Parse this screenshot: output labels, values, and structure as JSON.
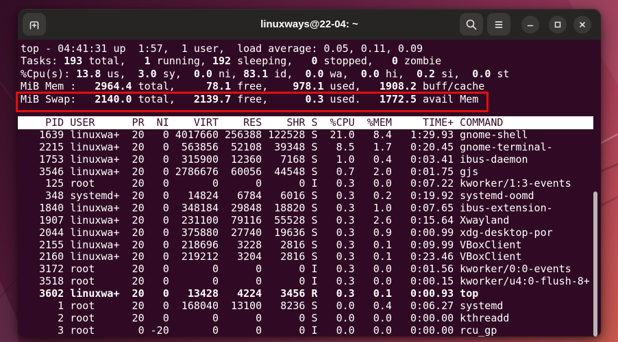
{
  "window": {
    "title": "linuxways@22-04: ~",
    "buttons": {
      "new_tab": "new-tab",
      "search": "search",
      "menu": "hamburger-menu",
      "minimize": "minimize",
      "maximize": "maximize",
      "close": "close"
    }
  },
  "colors": {
    "terminal_background": "#300a24",
    "titlebar_background": "#272424",
    "highlight_red": "#e60d0d",
    "header_invert_background": "#ffffff"
  },
  "terminal": {
    "summary": [
      [
        {
          "t": "top - 04:41:31 up  1:57,  1 user,  load average: 0.05, 0.11, 0.09",
          "b": false
        }
      ],
      [
        {
          "t": "Tasks: ",
          "b": false
        },
        {
          "t": "193",
          "b": true
        },
        {
          "t": " total,   ",
          "b": false
        },
        {
          "t": "1",
          "b": true
        },
        {
          "t": " running, ",
          "b": false
        },
        {
          "t": "192",
          "b": true
        },
        {
          "t": " sleeping,   ",
          "b": false
        },
        {
          "t": "0",
          "b": true
        },
        {
          "t": " stopped,   ",
          "b": false
        },
        {
          "t": "0",
          "b": true
        },
        {
          "t": " zombie",
          "b": false
        }
      ],
      [
        {
          "t": "%Cpu(s): ",
          "b": false
        },
        {
          "t": "13.8",
          "b": true
        },
        {
          "t": " us,  ",
          "b": false
        },
        {
          "t": "3.0",
          "b": true
        },
        {
          "t": " sy,  ",
          "b": false
        },
        {
          "t": "0.0",
          "b": true
        },
        {
          "t": " ni, ",
          "b": false
        },
        {
          "t": "83.1",
          "b": true
        },
        {
          "t": " id,  ",
          "b": false
        },
        {
          "t": "0.0",
          "b": true
        },
        {
          "t": " wa,  ",
          "b": false
        },
        {
          "t": "0.0",
          "b": true
        },
        {
          "t": " hi,  ",
          "b": false
        },
        {
          "t": "0.2",
          "b": true
        },
        {
          "t": " si,  ",
          "b": false
        },
        {
          "t": "0.0",
          "b": true
        },
        {
          "t": " st",
          "b": false
        }
      ],
      [
        {
          "t": "MiB Mem :   ",
          "b": false
        },
        {
          "t": "2964.4",
          "b": true
        },
        {
          "t": " total,     ",
          "b": false
        },
        {
          "t": "78.1",
          "b": true
        },
        {
          "t": " free,    ",
          "b": false
        },
        {
          "t": "978.1",
          "b": true
        },
        {
          "t": " used,   ",
          "b": false
        },
        {
          "t": "1908.2",
          "b": true
        },
        {
          "t": " buff/cache",
          "b": false
        }
      ],
      [
        {
          "t": "MiB Swap:   ",
          "b": false
        },
        {
          "t": "2140.0",
          "b": true
        },
        {
          "t": " total,   ",
          "b": false
        },
        {
          "t": "2139.7",
          "b": true
        },
        {
          "t": " free,      ",
          "b": false
        },
        {
          "t": "0.3",
          "b": true
        },
        {
          "t": " used.   ",
          "b": false
        },
        {
          "t": "1772.5",
          "b": true
        },
        {
          "t": " avail Mem",
          "b": false
        }
      ]
    ],
    "header": "    PID USER      PR  NI    VIRT    RES    SHR S  %CPU  %MEM     TIME+ COMMAND",
    "rows": [
      {
        "text": "   1639 linuxwa+  20   0 4017660 256388 122528 S  21.0   8.4   1:29.93 gnome-shell",
        "bold": false
      },
      {
        "text": "   2215 linuxwa+  20   0  563856  52108  39348 S   8.5   1.7   0:20.45 gnome-terminal-",
        "bold": false
      },
      {
        "text": "   1753 linuxwa+  20   0  315900  12360   7168 S   1.0   0.4   0:03.41 ibus-daemon",
        "bold": false
      },
      {
        "text": "   3546 linuxwa+  20   0 2786676  60056  44548 S   0.7   2.0   0:01.75 gjs",
        "bold": false
      },
      {
        "text": "    125 root      20   0       0      0      0 I   0.3   0.0   0:07.22 kworker/1:3-events",
        "bold": false
      },
      {
        "text": "    348 systemd+  20   0   14824   6784   6016 S   0.3   0.2   0:19.92 systemd-oomd",
        "bold": false
      },
      {
        "text": "   1840 linuxwa+  20   0  348184  29848  18820 S   0.3   1.0   0:07.65 ibus-extension-",
        "bold": false
      },
      {
        "text": "   1907 linuxwa+  20   0  231100  79116  55528 S   0.3   2.6   0:15.64 Xwayland",
        "bold": false
      },
      {
        "text": "   2044 linuxwa+  20   0  375880  27740  19636 S   0.3   0.9   0:00.99 xdg-desktop-por",
        "bold": false
      },
      {
        "text": "   2155 linuxwa+  20   0  218696   3228   2816 S   0.3   0.1   0:09.99 VBoxClient",
        "bold": false
      },
      {
        "text": "   2160 linuxwa+  20   0  219212   3204   2816 S   0.3   0.1   0:23.46 VBoxClient",
        "bold": false
      },
      {
        "text": "   3172 root      20   0       0      0      0 I   0.3   0.0   0:01.56 kworker/0:0-events",
        "bold": false
      },
      {
        "text": "   3518 root      20   0       0      0      0 I   0.3   0.0   0:00.15 kworker/u4:0-flush-8+",
        "bold": false
      },
      {
        "text": "   3602 linuxwa+  20   0   13428   4224   3456 R   0.3   0.1   0:00.93 top",
        "bold": true
      },
      {
        "text": "      1 root      20   0  168040  13100   8236 S   0.0   0.4   0:06.27 systemd",
        "bold": false
      },
      {
        "text": "      2 root      20   0       0      0      0 S   0.0   0.0   0:00.00 kthreadd",
        "bold": false
      },
      {
        "text": "      3 root       0 -20       0      0      0 I   0.0   0.0   0:00.00 rcu_gp",
        "bold": false
      }
    ]
  }
}
